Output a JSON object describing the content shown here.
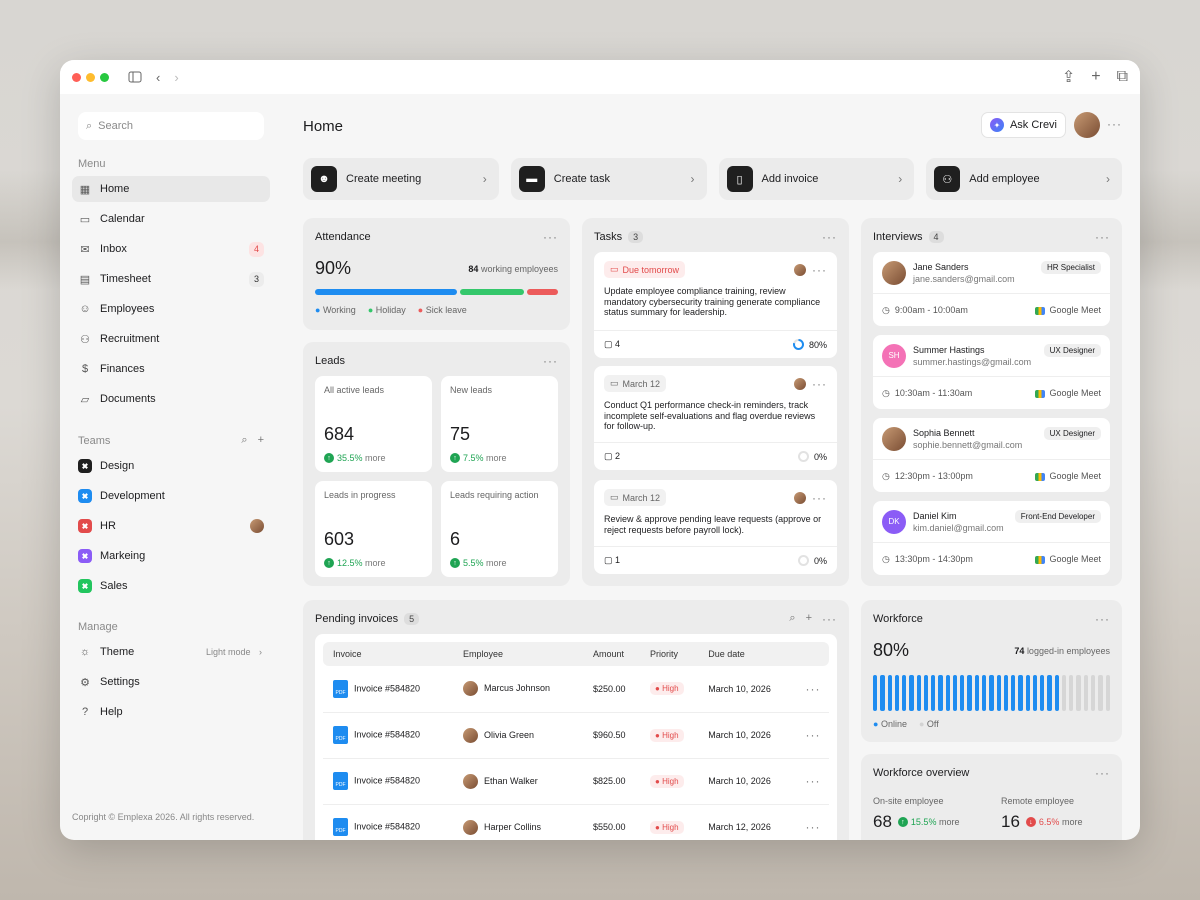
{
  "sidebar": {
    "search_placeholder": "Search",
    "menu_label": "Menu",
    "menu": [
      {
        "label": "Home",
        "icon": "grid-icon"
      },
      {
        "label": "Calendar",
        "icon": "calendar-icon"
      },
      {
        "label": "Inbox",
        "icon": "mail-icon",
        "badge": "4"
      },
      {
        "label": "Timesheet",
        "icon": "sheet-icon",
        "badge": "3"
      },
      {
        "label": "Employees",
        "icon": "people-icon"
      },
      {
        "label": "Recruitment",
        "icon": "user-plus-icon"
      },
      {
        "label": "Finances",
        "icon": "dollar-icon"
      },
      {
        "label": "Documents",
        "icon": "folder-icon"
      }
    ],
    "teams_label": "Teams",
    "teams": [
      {
        "label": "Design",
        "color": "#1f1f1f"
      },
      {
        "label": "Development",
        "color": "#1e8cf0"
      },
      {
        "label": "HR",
        "color": "#e24b4b"
      },
      {
        "label": "Markeing",
        "color": "#8b5cf6"
      },
      {
        "label": "Sales",
        "color": "#22c55e"
      }
    ],
    "manage_label": "Manage",
    "theme_label": "Theme",
    "theme_value": "Light mode",
    "settings_label": "Settings",
    "help_label": "Help",
    "copyright": "Copright © Emplexa 2026. All rights reserved."
  },
  "header": {
    "title": "Home",
    "ask": "Ask Crevi"
  },
  "actions": [
    {
      "label": "Create meeting"
    },
    {
      "label": "Create task"
    },
    {
      "label": "Add invoice"
    },
    {
      "label": "Add employee"
    }
  ],
  "attendance": {
    "title": "Attendance",
    "percent": "90%",
    "count": "84",
    "count_label": "working employees",
    "legend": [
      "Working",
      "Holiday",
      "Sick leave"
    ],
    "shares": {
      "working": 0.6,
      "holiday": 0.27,
      "sick": 0.13
    },
    "colors": {
      "working": "#1e8cf0",
      "holiday": "#34c76b",
      "sick": "#ec5b5b"
    }
  },
  "leads": {
    "title": "Leads",
    "cards": [
      {
        "label": "All active leads",
        "value": "684",
        "change": "35.5%",
        "more": "more"
      },
      {
        "label": "New leads",
        "value": "75",
        "change": "7.5%",
        "more": "more"
      },
      {
        "label": "Leads in progress",
        "value": "603",
        "change": "12.5%",
        "more": "more"
      },
      {
        "label": "Leads requiring action",
        "value": "6",
        "change": "5.5%",
        "more": "more"
      }
    ]
  },
  "tasks": {
    "title": "Tasks",
    "count": "3",
    "items": [
      {
        "tag": "Due tomorrow",
        "text": "Update employee compliance training, review mandatory cybersecurity training generate compliance status summary for leadership.",
        "comments": "4",
        "progress": "80%"
      },
      {
        "tag": "March 12",
        "text": "Conduct Q1 performance check-in reminders, track incomplete self-evaluations and flag overdue reviews for follow-up.",
        "comments": "2",
        "progress": "0%"
      },
      {
        "tag": "March 12",
        "text": "Review & approve pending leave requests (approve or reject requests before payroll lock).",
        "comments": "1",
        "progress": "0%"
      }
    ]
  },
  "interviews": {
    "title": "Interviews",
    "count": "4",
    "items": [
      {
        "name": "Jane Sanders",
        "email": "jane.sanders@gmail.com",
        "role": "HR Specialist",
        "time": "9:00am - 10:00am",
        "app": "Google Meet",
        "initials": ""
      },
      {
        "name": "Summer Hastings",
        "email": "summer.hastings@gmail.com",
        "role": "UX Designer",
        "time": "10:30am - 11:30am",
        "app": "Google Meet",
        "initials": "SH"
      },
      {
        "name": "Sophia Bennett",
        "email": "sophie.bennett@gmail.com",
        "role": "UX Designer",
        "time": "12:30pm - 13:00pm",
        "app": "Google Meet",
        "initials": ""
      },
      {
        "name": "Daniel Kim",
        "email": "kim.daniel@gmail.com",
        "role": "Front-End Developer",
        "time": "13:30pm - 14:30pm",
        "app": "Google Meet",
        "initials": "DK"
      }
    ]
  },
  "invoices": {
    "title": "Pending invoices",
    "count": "5",
    "columns": [
      "Invoice",
      "Employee",
      "Amount",
      "Priority",
      "Due date"
    ],
    "rows": [
      {
        "invoice": "Invoice #584820",
        "employee": "Marcus Johnson",
        "amount": "$250.00",
        "priority": "High",
        "due": "March 10, 2026"
      },
      {
        "invoice": "Invoice #584820",
        "employee": "Olivia Green",
        "amount": "$960.50",
        "priority": "High",
        "due": "March 10, 2026"
      },
      {
        "invoice": "Invoice #584820",
        "employee": "Ethan Walker",
        "amount": "$825.00",
        "priority": "High",
        "due": "March 10, 2026"
      },
      {
        "invoice": "Invoice #584820",
        "employee": "Harper Collins",
        "amount": "$550.00",
        "priority": "High",
        "due": "March 12, 2026"
      }
    ]
  },
  "workforce": {
    "title": "Workforce",
    "percent": "80%",
    "count": "74",
    "count_label": "logged-in employees",
    "legend": [
      "Online",
      "Off"
    ],
    "online_bars": 26,
    "total_bars": 33
  },
  "overview": {
    "title": "Workforce overview",
    "onsite_label": "On-site employee",
    "onsite_value": "68",
    "onsite_change": "15.5%",
    "remote_label": "Remote employee",
    "remote_value": "16",
    "remote_change": "6.5%",
    "more": "more"
  }
}
